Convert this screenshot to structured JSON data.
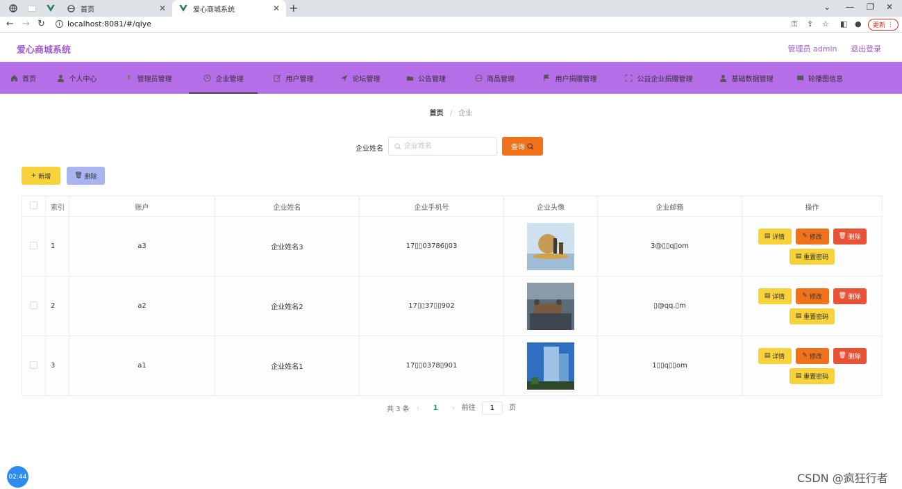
{
  "browser": {
    "tabs": [
      {
        "title": "首页"
      },
      {
        "title": "爱心商城系统"
      }
    ],
    "url": "localhost:8081/#/qiye",
    "update_label": "更新"
  },
  "header": {
    "title": "爱心商城系统",
    "user": "管理员 admin",
    "logout": "退出登录"
  },
  "menu": [
    {
      "label": "首页",
      "icon": "home-icon"
    },
    {
      "label": "个人中心",
      "icon": "user-icon"
    },
    {
      "label": "管理员管理",
      "icon": "microphone-icon"
    },
    {
      "label": "企业管理",
      "icon": "clock-icon",
      "active": true
    },
    {
      "label": "用户管理",
      "icon": "edit-icon"
    },
    {
      "label": "论坛管理",
      "icon": "send-icon"
    },
    {
      "label": "公告管理",
      "icon": "folder-icon"
    },
    {
      "label": "商品管理",
      "icon": "globe-icon"
    },
    {
      "label": "用户捐赠管理",
      "icon": "flag-icon"
    },
    {
      "label": "公益企业捐赠管理",
      "icon": "fullscreen-icon"
    },
    {
      "label": "基础数据管理",
      "icon": "user-icon"
    },
    {
      "label": "轮播图信息",
      "icon": "message-icon"
    }
  ],
  "breadcrumb": {
    "home": "首页",
    "current": "企业"
  },
  "search": {
    "label": "企业姓名",
    "placeholder": "企业姓名",
    "button": "查询"
  },
  "actions": {
    "add": "新增",
    "delete": "删除"
  },
  "table": {
    "headers": [
      "索引",
      "账户",
      "企业姓名",
      "企业手机号",
      "企业头像",
      "企业邮箱",
      "操作"
    ],
    "rows": [
      {
        "index": "1",
        "account": "a3",
        "name": "企业姓名3",
        "phone": "17▯▯03786▯03",
        "email": "3@▯▯q▯om",
        "img": "chess"
      },
      {
        "index": "2",
        "account": "a2",
        "name": "企业姓名2",
        "phone": "17▯▯37▯▯902",
        "email": "▯@qq.▯m",
        "img": "office"
      },
      {
        "index": "3",
        "account": "a1",
        "name": "企业姓名1",
        "phone": "17▯▯0378▯901",
        "email": "1▯▯q▯▯om",
        "img": "building"
      }
    ],
    "ops": {
      "detail": "详情",
      "edit": "修改",
      "remove": "删除",
      "reset": "重置密码"
    }
  },
  "pager": {
    "total": "共 3 条",
    "current": "1",
    "goto_prefix": "前往",
    "goto_value": "1",
    "goto_suffix": "页"
  },
  "timer": "02:44",
  "watermark": "CSDN @疯狂行者",
  "colors": {
    "brand": "#b56de8",
    "title": "#a35bd4",
    "search_btn": "#f0731b",
    "add_btn": "#f7d23b",
    "del_btn": "#a9b4f0"
  }
}
